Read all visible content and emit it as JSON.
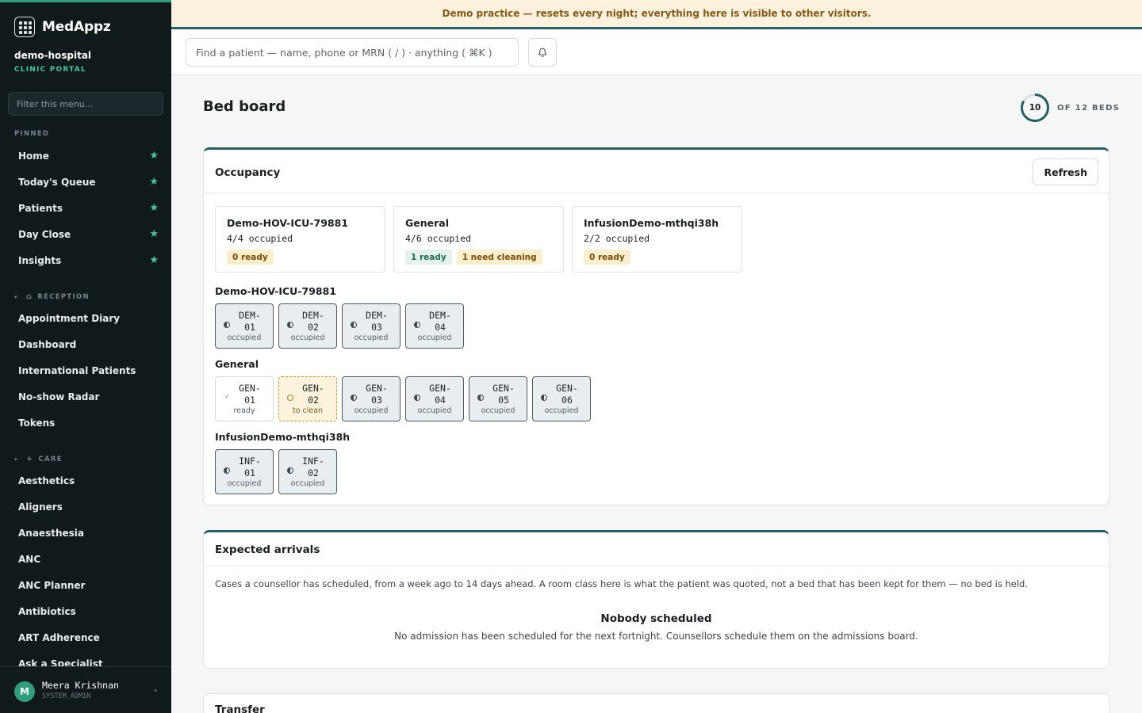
{
  "app": {
    "name": "MedAppz",
    "tenant": "demo-hospital",
    "portal": "CLINIC PORTAL"
  },
  "sidebar": {
    "filter_placeholder": "Filter this menu...",
    "pinned_label": "PINNED",
    "pinned": [
      {
        "label": "Home"
      },
      {
        "label": "Today's Queue"
      },
      {
        "label": "Patients"
      },
      {
        "label": "Day Close"
      },
      {
        "label": "Insights"
      }
    ],
    "reception_label": "RECEPTION",
    "reception": [
      {
        "label": "Appointment Diary"
      },
      {
        "label": "Dashboard"
      },
      {
        "label": "International Patients"
      },
      {
        "label": "No-show Radar"
      },
      {
        "label": "Tokens"
      }
    ],
    "care_label": "CARE",
    "care": [
      {
        "label": "Aesthetics"
      },
      {
        "label": "Aligners"
      },
      {
        "label": "Anaesthesia"
      },
      {
        "label": "ANC"
      },
      {
        "label": "ANC Planner"
      },
      {
        "label": "Antibiotics"
      },
      {
        "label": "ART Adherence"
      },
      {
        "label": "Ask a Specialist"
      }
    ],
    "user": {
      "initial": "M",
      "name": "Meera Krishnan",
      "role": "SYSTEM_ADMIN"
    }
  },
  "banner": {
    "text": "Demo practice — resets every night; everything here is visible to other visitors."
  },
  "topbar": {
    "search_placeholder": "Find a patient — name, phone or MRN ( / ) · anything ( ⌘K )"
  },
  "page": {
    "title": "Bed board",
    "beds_occupied": "10",
    "beds_total_label": "OF 12 BEDS",
    "occupied_fraction": 0.8333
  },
  "occupancy": {
    "title": "Occupancy",
    "refresh_label": "Refresh",
    "summaries": [
      {
        "name": "Demo-HOV-ICU-79881",
        "occupied": "4/4 occupied",
        "badges": [
          {
            "text": "0 ready",
            "tone": "amber"
          }
        ]
      },
      {
        "name": "General",
        "occupied": "4/6 occupied",
        "badges": [
          {
            "text": "1 ready",
            "tone": "green"
          },
          {
            "text": "1 need cleaning",
            "tone": "amber"
          }
        ]
      },
      {
        "name": "InfusionDemo-mthqi38h",
        "occupied": "2/2 occupied",
        "badges": [
          {
            "text": "0 ready",
            "tone": "amber"
          }
        ]
      }
    ],
    "wards": [
      {
        "name": "Demo-HOV-ICU-79881",
        "beds": [
          {
            "code": "DEM-01",
            "status": "occupied"
          },
          {
            "code": "DEM-02",
            "status": "occupied"
          },
          {
            "code": "DEM-03",
            "status": "occupied"
          },
          {
            "code": "DEM-04",
            "status": "occupied"
          }
        ]
      },
      {
        "name": "General",
        "beds": [
          {
            "code": "GEN-01",
            "status": "ready"
          },
          {
            "code": "GEN-02",
            "status": "to clean"
          },
          {
            "code": "GEN-03",
            "status": "occupied"
          },
          {
            "code": "GEN-04",
            "status": "occupied"
          },
          {
            "code": "GEN-05",
            "status": "occupied"
          },
          {
            "code": "GEN-06",
            "status": "occupied"
          }
        ]
      },
      {
        "name": "InfusionDemo-mthqi38h",
        "beds": [
          {
            "code": "INF-01",
            "status": "occupied"
          },
          {
            "code": "INF-02",
            "status": "occupied"
          }
        ]
      }
    ]
  },
  "arrivals": {
    "title": "Expected arrivals",
    "description": "Cases a counsellor has scheduled, from a week ago to 14 days ahead. A room class here is what the patient was quoted, not a bed that has been kept for them — no bed is held.",
    "empty_title": "Nobody scheduled",
    "empty_description": "No admission has been scheduled for the next fortnight. Counsellors schedule them on the admissions board."
  },
  "transfer": {
    "title": "Transfer"
  },
  "colors": {
    "accent": "#2e9e7f",
    "sidebar_bg": "#10191c",
    "card_border": "#245e66",
    "banner_bg": "#fcf1dc"
  }
}
